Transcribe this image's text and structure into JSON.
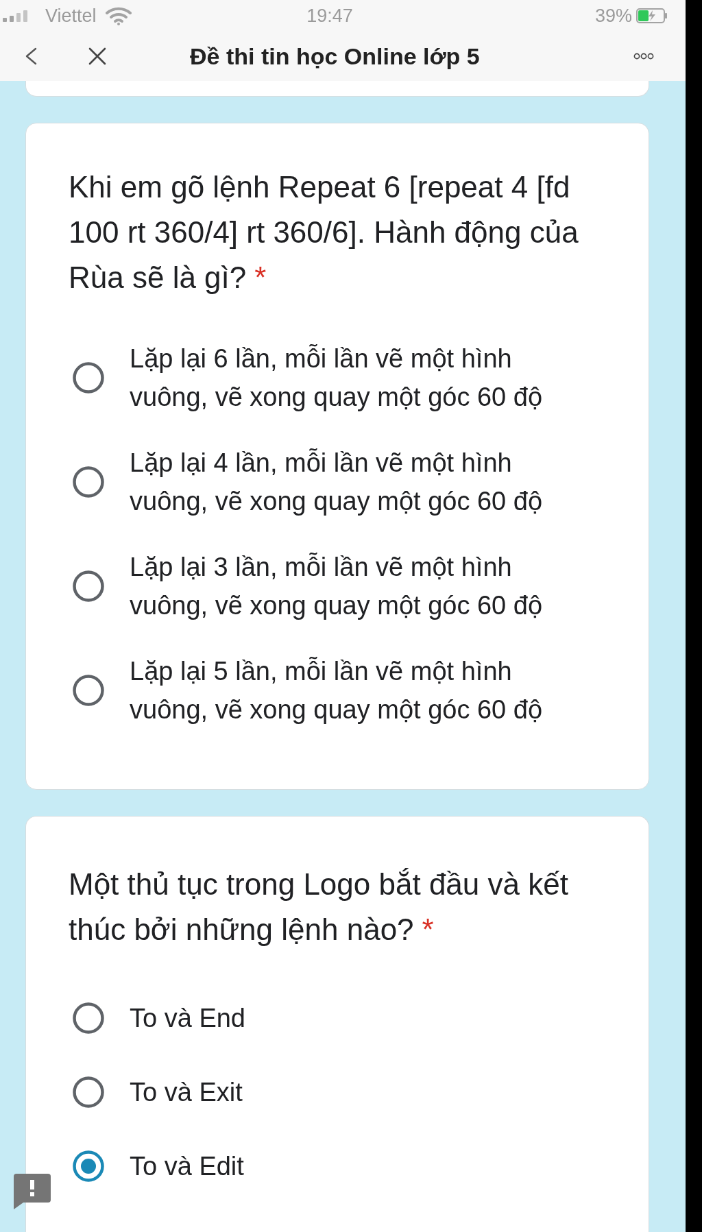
{
  "status_bar": {
    "carrier": "Viettel",
    "time": "19:47",
    "battery": "39%"
  },
  "nav_bar": {
    "title": "Đề thi tin học Online lớp 5"
  },
  "questions": [
    {
      "text": "Khi em gõ lệnh Repeat 6 [repeat 4 [fd 100 rt 360/4] rt 360/6]. Hành động của Rùa sẽ là gì?",
      "required_mark": "*",
      "options": [
        {
          "label": "Lặp lại 6 lần, mỗi lần vẽ một hình vuông, vẽ xong quay một góc 60 độ",
          "selected": false
        },
        {
          "label": "Lặp lại 4 lần, mỗi lần vẽ một hình vuông, vẽ xong quay một góc 60 độ",
          "selected": false
        },
        {
          "label": "Lặp lại 3 lần, mỗi lần vẽ một hình vuông, vẽ xong quay một góc 60 độ",
          "selected": false
        },
        {
          "label": "Lặp lại 5 lần, mỗi lần vẽ một hình vuông, vẽ xong quay một góc 60 độ",
          "selected": false
        }
      ]
    },
    {
      "text": "Một thủ tục trong Logo bắt đầu và kết thúc bởi những lệnh nào?",
      "required_mark": "*",
      "options": [
        {
          "label": "To và End",
          "selected": false
        },
        {
          "label": "To và Exit",
          "selected": false
        },
        {
          "label": "To và Edit",
          "selected": true
        }
      ]
    }
  ]
}
